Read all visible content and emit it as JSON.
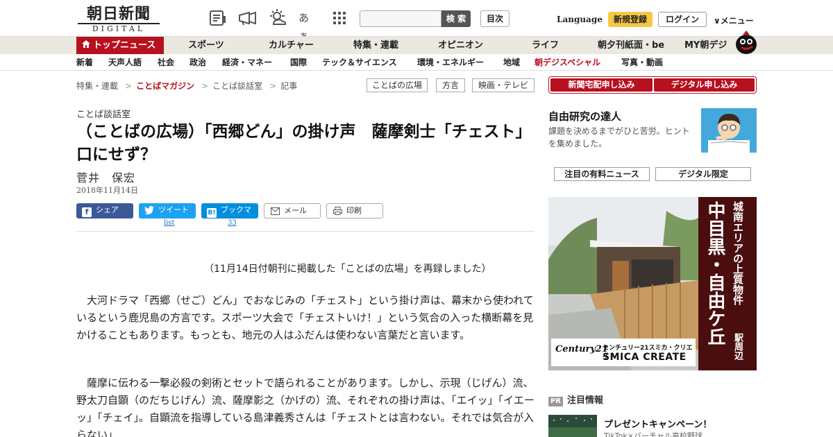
{
  "header": {
    "logo_jp": "朝日新聞",
    "logo_digital": "DIGITAL",
    "search_placeholder": "",
    "search_button": "検 索",
    "toc_button": "目次",
    "language": "Language",
    "register": "新規登録",
    "login": "ログイン",
    "menu": "メニュー",
    "fontsize_label": "あぁ",
    "icons": [
      "newspaper-icon",
      "megaphone-icon",
      "weather-icon",
      "font-size-icon",
      "grid-icon"
    ]
  },
  "nav1": [
    "トップニュース",
    "スポーツ",
    "カルチャー",
    "特集・連載",
    "オピニオン",
    "ライフ",
    "朝夕刊紙面・be",
    "MY朝デジ"
  ],
  "nav2": [
    "新着",
    "天声人語",
    "社会",
    "政治",
    "経済・マネー",
    "国際",
    "テック＆サイエンス",
    "環境・エネルギー",
    "地域",
    "朝デジスペシャル",
    "写真・動画"
  ],
  "breadcrumb": [
    "特集・連載",
    "ことばマガジン",
    "ことば談話室",
    "記事"
  ],
  "tag_buttons": [
    "ことばの広場",
    "方言",
    "映画・テレビ"
  ],
  "article": {
    "kicker": "ことば談話室",
    "title": "（ことばの広場）「西郷どん」の掛け声　薩摩剣士「チェスト」口にせず？",
    "author": "菅井　保宏",
    "date": "2018年11月14日",
    "share": {
      "facebook": "シェア",
      "twitter": "ツイート",
      "twitter_count": "list",
      "hatena": "ブックマーク",
      "hatena_count": "33",
      "mail": "メール",
      "print": "印刷"
    },
    "note": "（11月14日付朝刊に掲載した「ことばの広場」を再録しました）",
    "paragraphs": [
      "大河ドラマ「西郷（せご）どん」でおなじみの「チェスト」という掛け声は、幕末から使われているという鹿児島の方言です。スポーツ大会で「チェストいけ！」という気合の入った横断幕を見かけることもあります。もっとも、地元の人はふだんは使わない言葉だと言います。",
      "薩摩に伝わる一撃必殺の剣術とセットで語られることがあります。しかし、示現（じげん）流、野太刀自顕（のだちじげん）流、薩摩影之（かげの）流、それぞれの掛け声は、「エイッ」「イエーッ」「チェイ」。自顕流を指導している島津義秀さんは「チェストとは言わない。それでは気合が入らない」"
    ]
  },
  "sidebar": {
    "delivery": "新聞宅配申し込み",
    "digital": "デジタル申し込み",
    "feature_title": "自由研究の達人",
    "feature_desc": "課題を決めるまでがひと苦労。ヒントを集めました。",
    "tab_paid": "注目の有料ニュース",
    "tab_digital": "デジタル限定",
    "ad": {
      "line1": "城南エリアの上質物件",
      "line2": "中目黒・自由ケ丘",
      "line3": "駅周辺",
      "brand_logo": "Century21",
      "brand_jp": "センチュリー21スミカ・クリエイト",
      "brand_en": "SMICA CREATE"
    },
    "pr_badge": "PR",
    "pr_head": "注目情報",
    "pr_title": "プレゼントキャンペーン！",
    "pr_sub": "TikTok×バーチャル高校野球"
  }
}
